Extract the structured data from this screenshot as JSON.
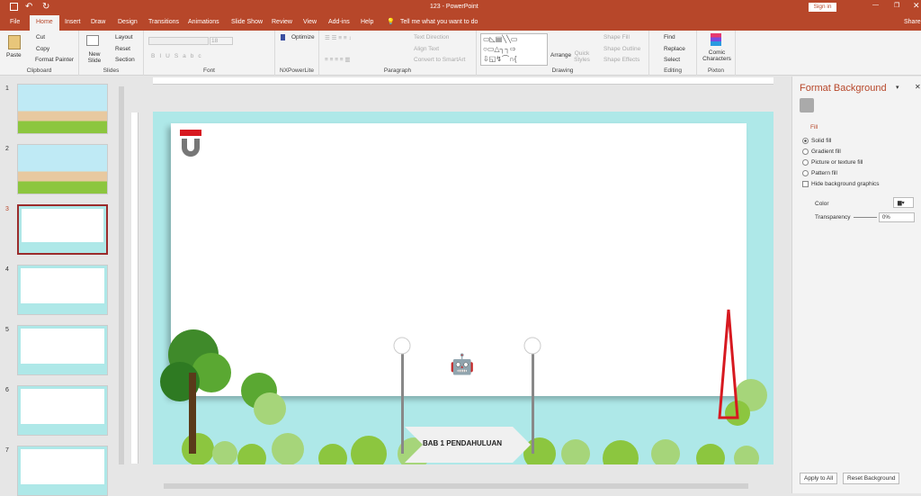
{
  "title": "123  -  PowerPoint",
  "sign_in": "Sign in",
  "share": "Share",
  "tabs": [
    "File",
    "Home",
    "Insert",
    "Draw",
    "Design",
    "Transitions",
    "Animations",
    "Slide Show",
    "Review",
    "View",
    "Add-ins",
    "Help"
  ],
  "tell_me": "Tell me what you want to do",
  "ribbon": {
    "clipboard": {
      "label": "Clipboard",
      "paste": "Paste",
      "cut": "Cut",
      "copy": "Copy",
      "format_painter": "Format Painter"
    },
    "slides": {
      "label": "Slides",
      "new_slide": "New Slide",
      "layout": "Layout",
      "reset": "Reset",
      "section": "Section"
    },
    "font": {
      "label": "Font",
      "size": "18"
    },
    "nx": {
      "label": "NXPowerLite",
      "optimize": "Optimize"
    },
    "paragraph": {
      "label": "Paragraph",
      "text_direction": "Text Direction",
      "align_text": "Align Text",
      "smartart": "Convert to SmartArt"
    },
    "drawing": {
      "label": "Drawing",
      "arrange": "Arrange",
      "quick_styles": "Quick Styles",
      "shape_fill": "Shape Fill",
      "shape_outline": "Shape Outline",
      "shape_effects": "Shape Effects"
    },
    "editing": {
      "label": "Editing",
      "find": "Find",
      "replace": "Replace",
      "select": "Select"
    },
    "pixton": {
      "label": "Pixton",
      "comic": "Comic Characters"
    }
  },
  "slides": [
    {
      "n": "1"
    },
    {
      "n": "2"
    },
    {
      "n": "3",
      "selected": true
    },
    {
      "n": "4"
    },
    {
      "n": "5"
    },
    {
      "n": "6"
    },
    {
      "n": "7"
    }
  ],
  "slide": {
    "banner": "BAB 1 PENDAHULUAN",
    "bg_color": "#aee8e8"
  },
  "format_bg": {
    "title": "Format Background",
    "section": "Fill",
    "options": [
      "Solid fill",
      "Gradient fill",
      "Picture or texture fill",
      "Pattern fill"
    ],
    "selected": "Solid fill",
    "hide_bg": "Hide background graphics",
    "hide_bg_checked": false,
    "color_label": "Color",
    "transparency_label": "Transparency",
    "transparency": "0%",
    "apply_all": "Apply to All",
    "reset": "Reset Background"
  },
  "accent": "#b7472a"
}
